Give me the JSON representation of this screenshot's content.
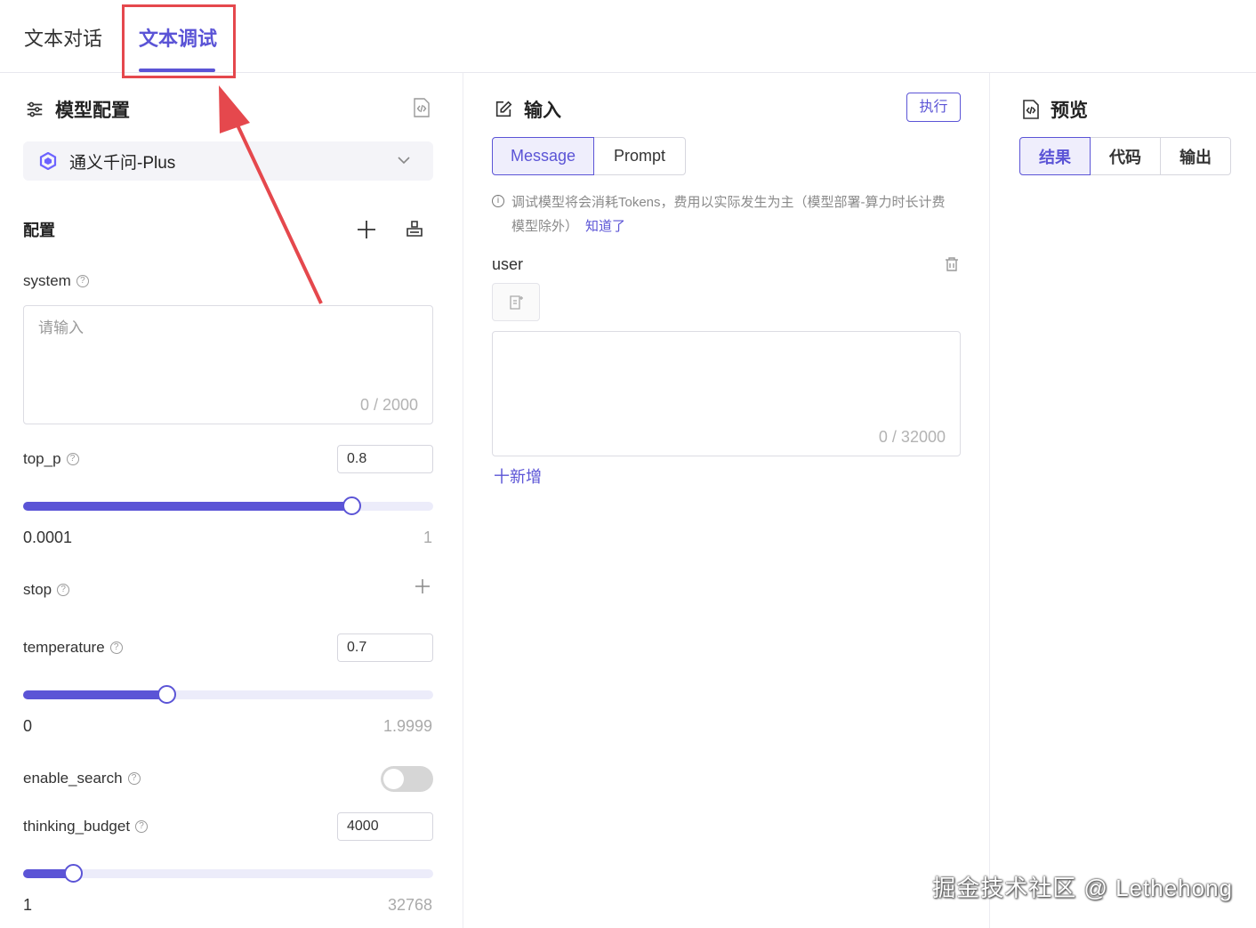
{
  "tabs": [
    {
      "label": "文本对话",
      "active": false
    },
    {
      "label": "文本调试",
      "active": true
    }
  ],
  "model_config": {
    "title": "模型配置",
    "model": "通义千问-Plus",
    "config_label": "配置",
    "system": {
      "label": "system",
      "placeholder": "请输入",
      "counter": "0 / 2000"
    },
    "top_p": {
      "label": "top_p",
      "value": "0.8",
      "min": "0.0001",
      "max": "1",
      "fraction": 0.8
    },
    "stop": {
      "label": "stop"
    },
    "temperature": {
      "label": "temperature",
      "value": "0.7",
      "min": "0",
      "max": "1.9999",
      "fraction": 0.35
    },
    "enable_search": {
      "label": "enable_search",
      "on": false
    },
    "thinking_budget": {
      "label": "thinking_budget",
      "value": "4000",
      "min": "1",
      "max": "32768",
      "fraction": 0.122
    }
  },
  "input": {
    "title": "输入",
    "exec_label": "执行",
    "modes": [
      "Message",
      "Prompt"
    ],
    "active_mode": "Message",
    "notice": "调试模型将会消耗Tokens，费用以实际发生为主（模型部署-算力时长计费模型除外）",
    "notice_link": "知道了",
    "role": "user",
    "counter": "0 / 32000",
    "add_label": "十新增"
  },
  "preview": {
    "title": "预览",
    "tabs": [
      "结果",
      "代码",
      "输出"
    ],
    "active_tab": "结果"
  },
  "watermark": "掘金技术社区 @ Lethehong",
  "colors": {
    "accent": "#5b54d6",
    "highlight": "#e5484d"
  }
}
